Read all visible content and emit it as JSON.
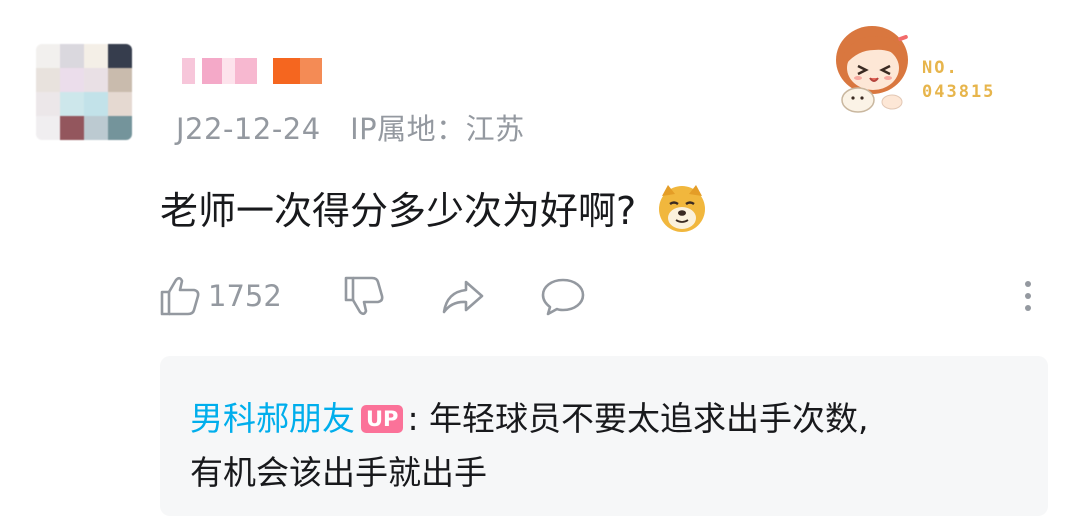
{
  "comment": {
    "date": "J22-12-24",
    "ip_label": "IP属地：江苏",
    "text": "老师一次得分多少次为好啊?",
    "like_count": "1752"
  },
  "fan_badge": {
    "no_label": "NO.",
    "number": "043815"
  },
  "reply": {
    "author": "男科郝朋友",
    "up_tag": "UP",
    "text_line1": ": 年轻球员不要太追求出手次数,",
    "text_line2": "有机会该出手就出手"
  },
  "colors": {
    "accent_blue": "#00aeec",
    "up_pink": "#fb7299",
    "meta_gray": "#9499a0",
    "badge_gold": "#e7b54c"
  }
}
